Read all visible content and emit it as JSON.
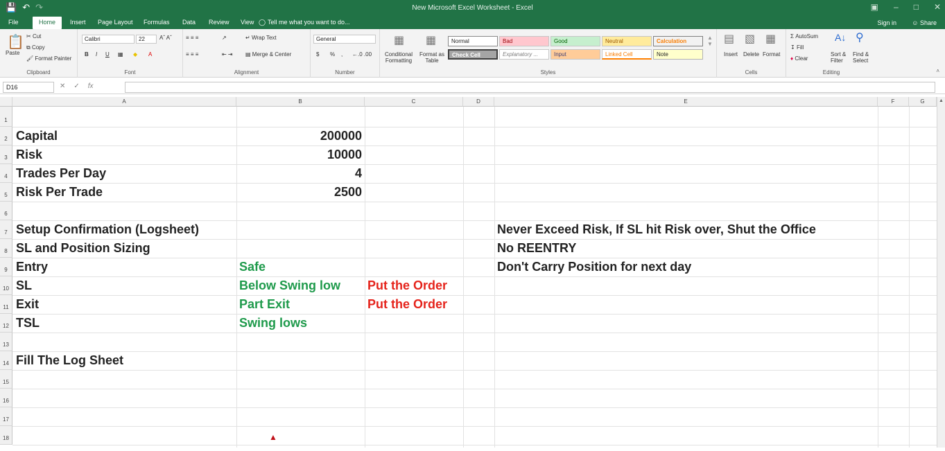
{
  "titlebar": {
    "title": "New Microsoft Excel Worksheet - Excel",
    "save_icon": "save-icon",
    "undo_icon": "undo-icon",
    "redo_icon": "redo-icon"
  },
  "tabs": [
    {
      "label": "File"
    },
    {
      "label": "Home"
    },
    {
      "label": "Insert"
    },
    {
      "label": "Page Layout"
    },
    {
      "label": "Formulas"
    },
    {
      "label": "Data"
    },
    {
      "label": "Review"
    },
    {
      "label": "View"
    },
    {
      "label": "Tell me what you want to do..."
    }
  ],
  "account": {
    "signin": "Sign in",
    "share": "Share"
  },
  "clipboard": {
    "paste": "Paste",
    "cut": "Cut",
    "copy": "Copy",
    "format_painter": "Format Painter",
    "label": "Clipboard"
  },
  "font": {
    "name": "Calibri",
    "size": "22",
    "label": "Font",
    "bold": "B",
    "italic": "I",
    "underline": "U"
  },
  "alignment": {
    "wrap": "Wrap Text",
    "merge": "Merge & Center",
    "label": "Alignment"
  },
  "number": {
    "format": "General",
    "currency": "$",
    "percent": "%",
    "comma": ",",
    "label": "Number"
  },
  "styles": {
    "conditional": "Conditional Formatting",
    "format_table": "Format as Table",
    "label": "Styles",
    "cells": [
      "Normal",
      "Bad",
      "Good",
      "Neutral",
      "Calculation",
      "Check Cell",
      "Explanatory ...",
      "Input",
      "Linked Cell",
      "Note"
    ]
  },
  "cells_group": {
    "insert": "Insert",
    "delete": "Delete",
    "format": "Format",
    "label": "Cells"
  },
  "editing": {
    "autosum": "AutoSum",
    "fill": "Fill",
    "clear": "Clear",
    "sort": "Sort & Filter",
    "find": "Find & Select",
    "label": "Editing"
  },
  "formula_bar": {
    "name_box": "D16",
    "fx": "fx",
    "value": ""
  },
  "columns": [
    "A",
    "B",
    "C",
    "D",
    "E",
    "F",
    "G"
  ],
  "rows": [
    "1",
    "2",
    "3",
    "4",
    "5",
    "6",
    "7",
    "8",
    "9",
    "10",
    "11",
    "12",
    "13",
    "14",
    "15",
    "16",
    "17",
    "18"
  ],
  "sheet": {
    "a2": "Capital",
    "b2": "200000",
    "a3": "Risk",
    "b3": "10000",
    "a4": "Trades Per Day",
    "b4": "4",
    "a5": "Risk Per Trade",
    "b5": "2500",
    "a7": "Setup Confirmation (Logsheet)",
    "a8": "SL and Position Sizing",
    "a9": "Entry",
    "b9": "Safe",
    "a10": "SL",
    "b10": "Below Swing low",
    "c10": "Put the Order",
    "a11": "Exit",
    "b11": "Part Exit",
    "c11": "Put the Order",
    "a12": "TSL",
    "b12": "Swing lows",
    "a14": "Fill The Log Sheet",
    "e7": "Never Exceed Risk, If SL hit Risk over, Shut the Office",
    "e8": "No REENTRY",
    "e9": "Don't Carry Position for next day"
  },
  "colors": {
    "accent": "#217346",
    "green_text": "#1e9a4b",
    "red_text": "#e5231b"
  }
}
